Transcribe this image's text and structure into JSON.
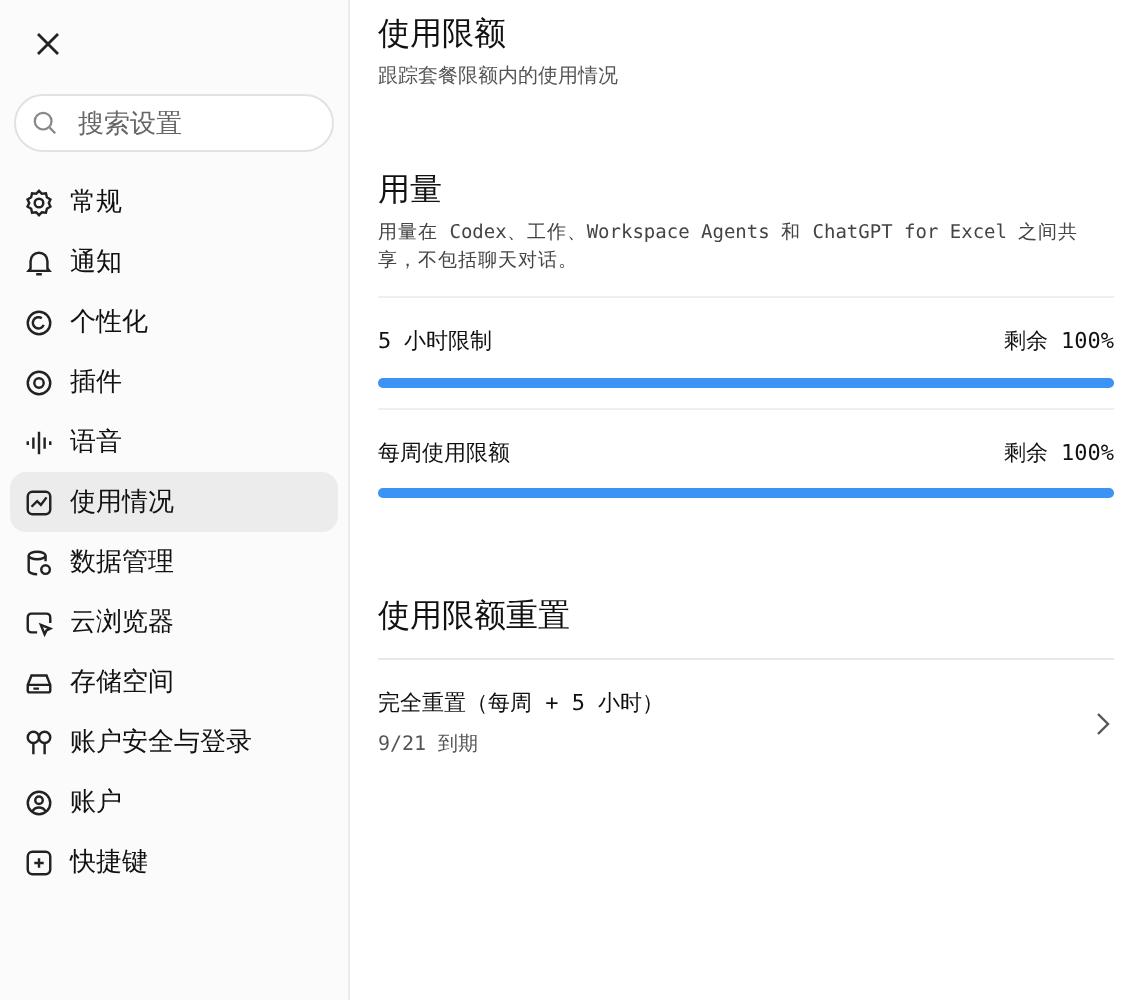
{
  "sidebar": {
    "search": {
      "placeholder": "搜索设置"
    },
    "items": [
      {
        "label": "常规",
        "selected": false
      },
      {
        "label": "通知",
        "selected": false
      },
      {
        "label": "个性化",
        "selected": false
      },
      {
        "label": "插件",
        "selected": false
      },
      {
        "label": "语音",
        "selected": false
      },
      {
        "label": "使用情况",
        "selected": true
      },
      {
        "label": "数据管理",
        "selected": false
      },
      {
        "label": "云浏览器",
        "selected": false
      },
      {
        "label": "存储空间",
        "selected": false
      },
      {
        "label": "账户安全与登录",
        "selected": false
      },
      {
        "label": "账户",
        "selected": false
      },
      {
        "label": "快捷键",
        "selected": false
      }
    ]
  },
  "page": {
    "title": "使用限额",
    "subtitle": "跟踪套餐限额内的使用情况"
  },
  "usage": {
    "heading": "用量",
    "description": "用量在 Codex、工作、Workspace Agents 和 ChatGPT for Excel 之间共享，不包括聊天对话。",
    "meters": [
      {
        "label": "5 小时限制",
        "reading": "剩余 100%",
        "level": 1
      },
      {
        "label": "每周使用限额",
        "reading": "剩余 100%",
        "level": 1
      }
    ]
  },
  "reset": {
    "heading": "使用限额重置",
    "items": [
      {
        "title": "完全重置（每周 + 5 小时）",
        "note": "9/21 到期"
      }
    ]
  }
}
